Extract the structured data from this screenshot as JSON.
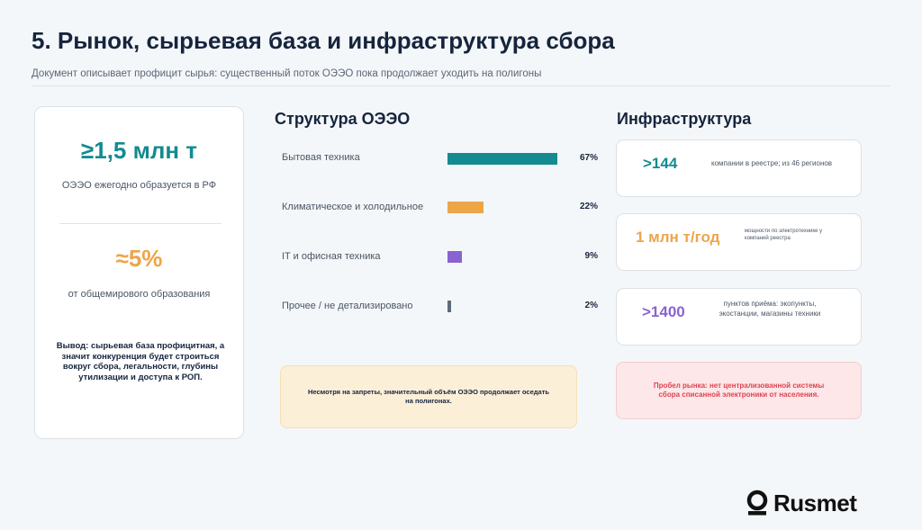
{
  "header": {
    "title": "5. Рынок, сырьевая база и инфраструктура сбора",
    "subtitle": "Документ описывает профицит сырья: существенный поток ОЭЭО пока продолжает уходить на полигоны"
  },
  "left_card": {
    "metric1_value": "≥1,5 млн т",
    "metric1_desc": "ОЭЭО ежегодно образуется в РФ",
    "metric2_value": "≈5%",
    "metric2_desc": "от общемирового образования",
    "conclusion": "Вывод: сырьевая база профицитная, а значит конкуренция будет строиться вокруг сбора, легальности, глубины утилизации и доступа к РОП."
  },
  "structure": {
    "title": "Структура ОЭЭО",
    "items": [
      {
        "label": "Бытовая техника",
        "value": 67,
        "pct": "67%",
        "color": "#138b90"
      },
      {
        "label": "Климатическое и холодильное",
        "value": 22,
        "pct": "22%",
        "color": "#eda54a"
      },
      {
        "label": "IT и офисная техника",
        "value": 9,
        "pct": "9%",
        "color": "#8a63d2"
      },
      {
        "label": "Прочее / не детализировано",
        "value": 2,
        "pct": "2%",
        "color": "#5f6b7a"
      }
    ],
    "note": "Несмотря на запреты, значительный объём ОЭЭО продолжает оседать на полигонах."
  },
  "infrastructure": {
    "title": "Инфраструктура",
    "cards": [
      {
        "value": ">144",
        "desc": "компании в реестре; из 46 регионов",
        "color": "#138b90"
      },
      {
        "value": "1 млн т/год",
        "desc": "мощности по электротехнике у компаний реестра",
        "color": "#eda54a"
      },
      {
        "value": ">1400",
        "desc": "пунктов приёма: экопункты, экостанции, магазины техники",
        "color": "#8a63d2"
      }
    ],
    "gap_note": "Пробел рынка: нет централизованной системы сбора списанной электроники от населения."
  },
  "brand": {
    "name": "Rusmet"
  }
}
